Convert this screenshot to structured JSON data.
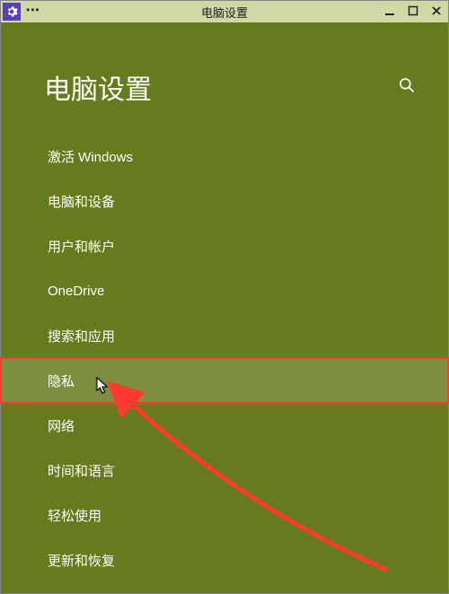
{
  "titlebar": {
    "title": "电脑设置",
    "dots": "•••"
  },
  "header": {
    "title": "电脑设置"
  },
  "nav": {
    "items": [
      {
        "label": "激活 Windows"
      },
      {
        "label": "电脑和设备"
      },
      {
        "label": "用户和帐户"
      },
      {
        "label": "OneDrive"
      },
      {
        "label": "搜索和应用"
      },
      {
        "label": "隐私"
      },
      {
        "label": "网络"
      },
      {
        "label": "时间和语言"
      },
      {
        "label": "轻松使用"
      },
      {
        "label": "更新和恢复"
      }
    ],
    "highlighted_index": 5
  },
  "annotation": {
    "highlight_color": "#ff3a2f"
  }
}
